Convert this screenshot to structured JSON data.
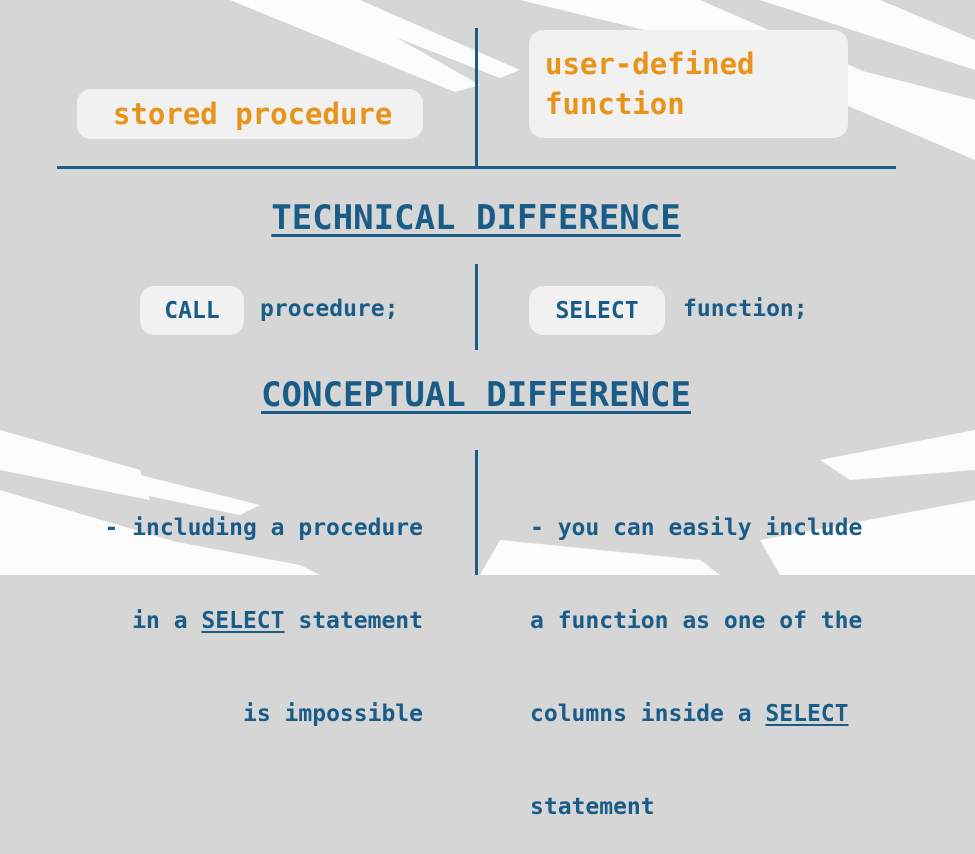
{
  "header": {
    "left_label": "stored procedure",
    "right_label_line1": "user-defined",
    "right_label_line2": "function"
  },
  "technical": {
    "heading": "TECHNICAL DIFFERENCE",
    "left_keyword": "CALL",
    "left_code": "procedure;",
    "right_keyword": "SELECT",
    "right_code": "function;"
  },
  "conceptual": {
    "heading": "CONCEPTUAL DIFFERENCE",
    "left_line1": "- including a procedure",
    "left_line2_pre": "in a ",
    "left_line2_kw": "SELECT",
    "left_line2_post": " statement",
    "left_line3": "is impossible",
    "right_line1": "- you can easily include",
    "right_line2": "a function as one of the",
    "right_line3_pre": "columns inside a ",
    "right_line3_kw": "SELECT",
    "right_line4": "statement"
  },
  "colors": {
    "background": "#d6d6d6",
    "brush_strokes": "#ffffff",
    "card": "#f1f1f1",
    "accent_orange": "#e8941a",
    "accent_blue": "#1a5c88"
  }
}
